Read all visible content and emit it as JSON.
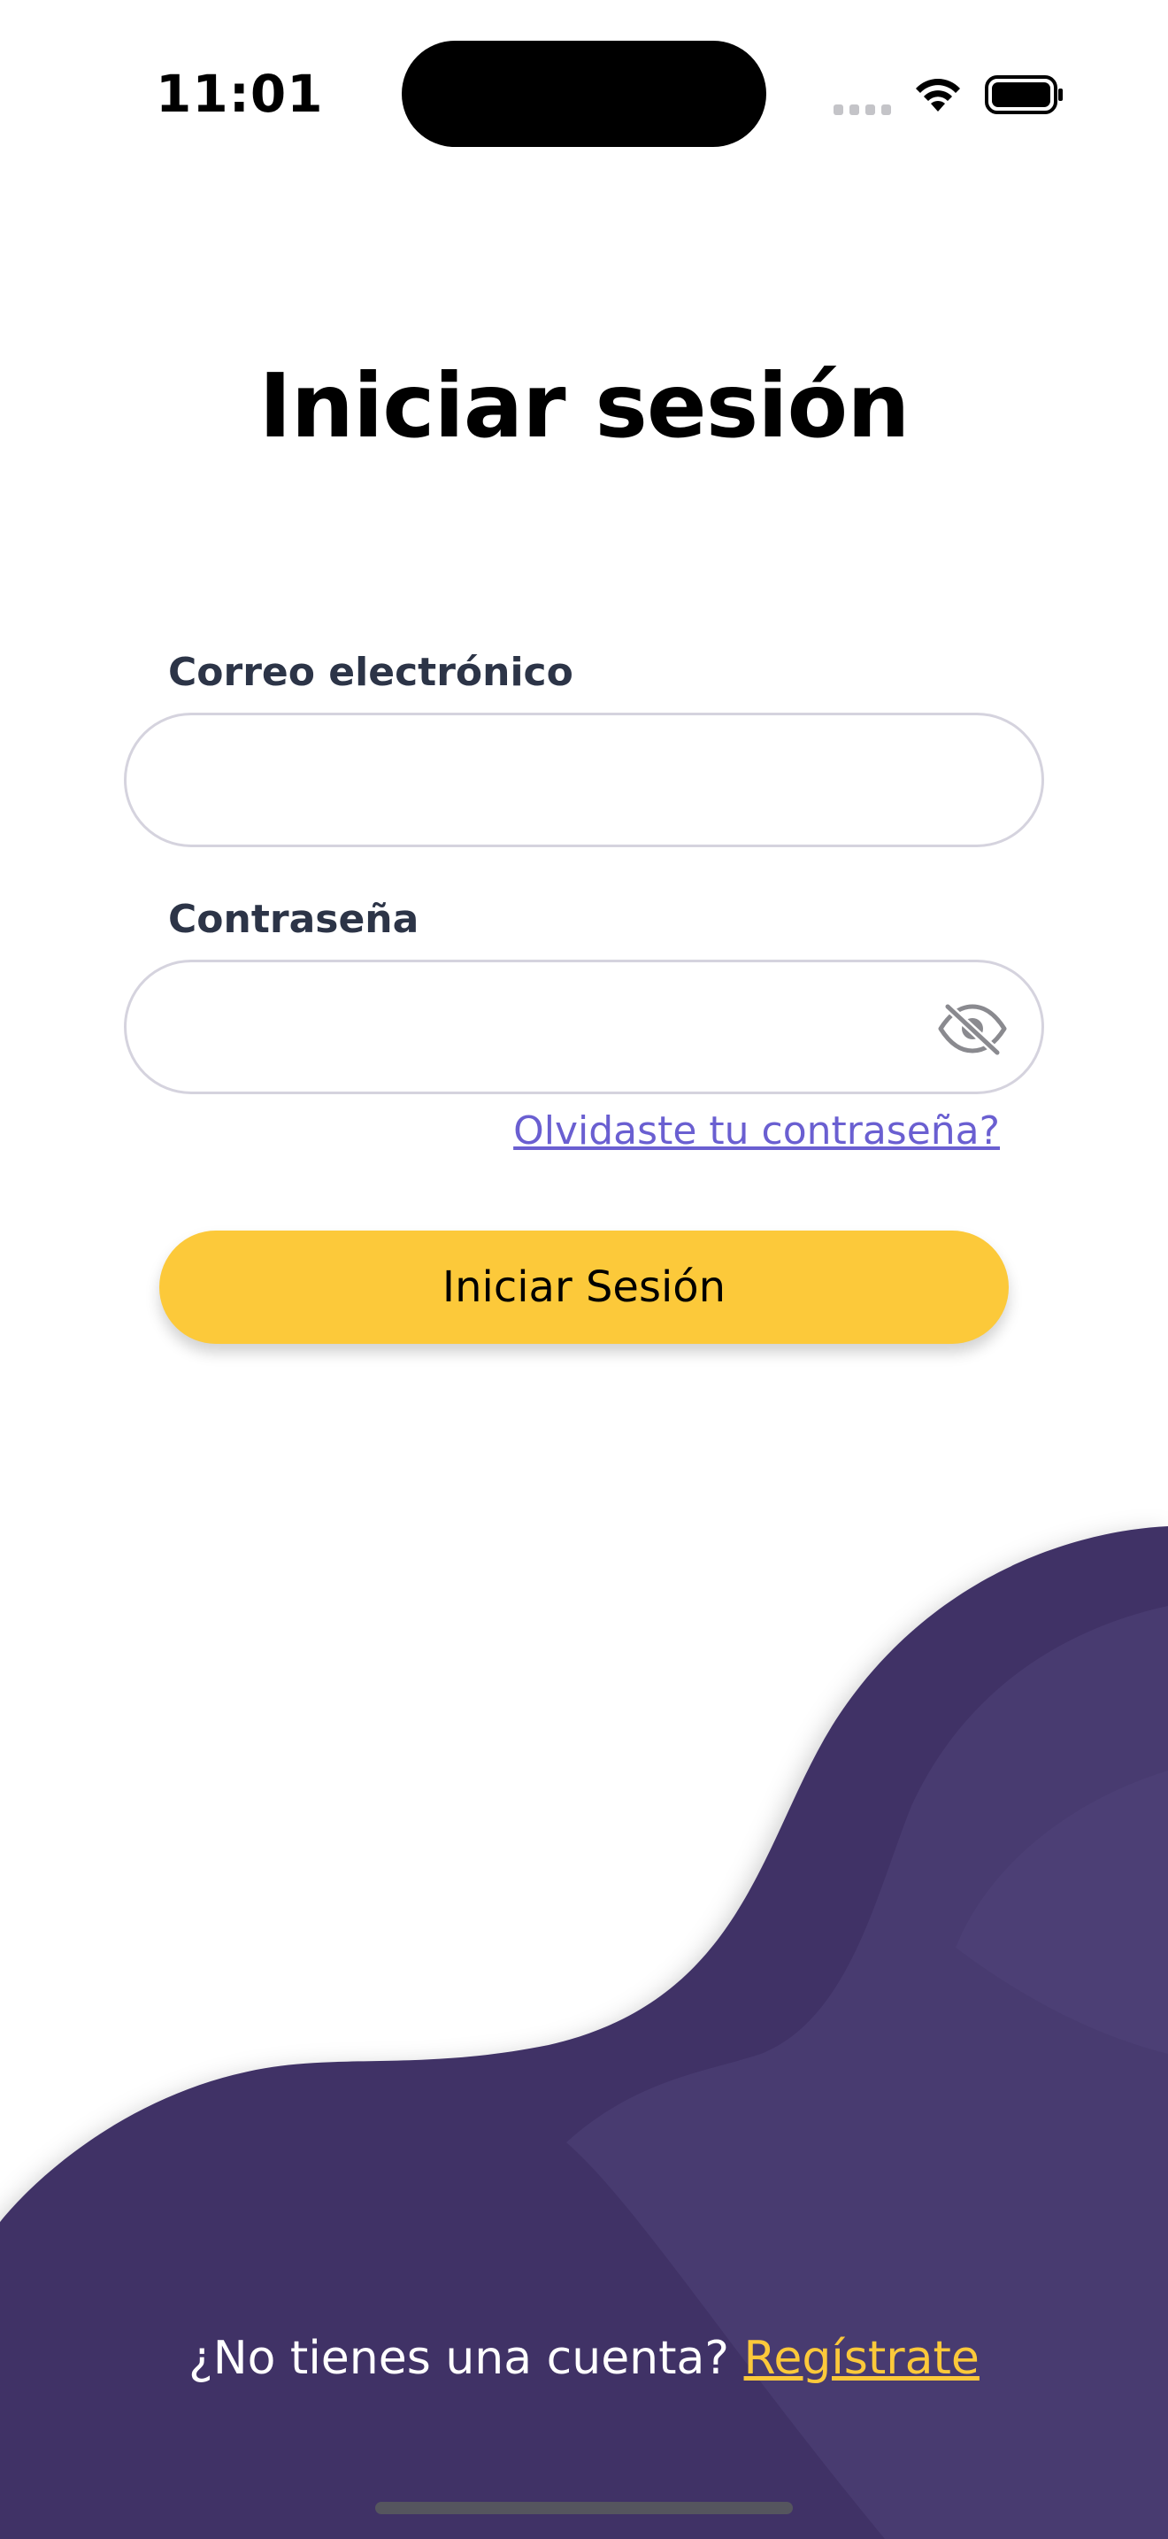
{
  "status_bar": {
    "time": "11:01"
  },
  "icons": {
    "cell": "cellular-signal-icon",
    "wifi": "wifi-icon",
    "battery": "battery-icon",
    "eye": "eye-slash-icon"
  },
  "login": {
    "title": "Iniciar sesión",
    "email_label": "Correo electrónico",
    "email_value": "",
    "email_placeholder": "",
    "password_label": "Contraseña",
    "password_value": "",
    "password_placeholder": "",
    "forgot_password": "Olvidaste tu contraseña?",
    "submit_label": "Iniciar Sesión"
  },
  "signup": {
    "prompt": "¿No tienes una cuenta?",
    "link": "Regístrate"
  },
  "colors": {
    "primary_yellow": "#fcc93a",
    "wave_purple": "#3f3166",
    "wave_purple_light": "#4a3d72",
    "link_purple": "#6a5fd1",
    "label_dark": "#2c3447"
  }
}
